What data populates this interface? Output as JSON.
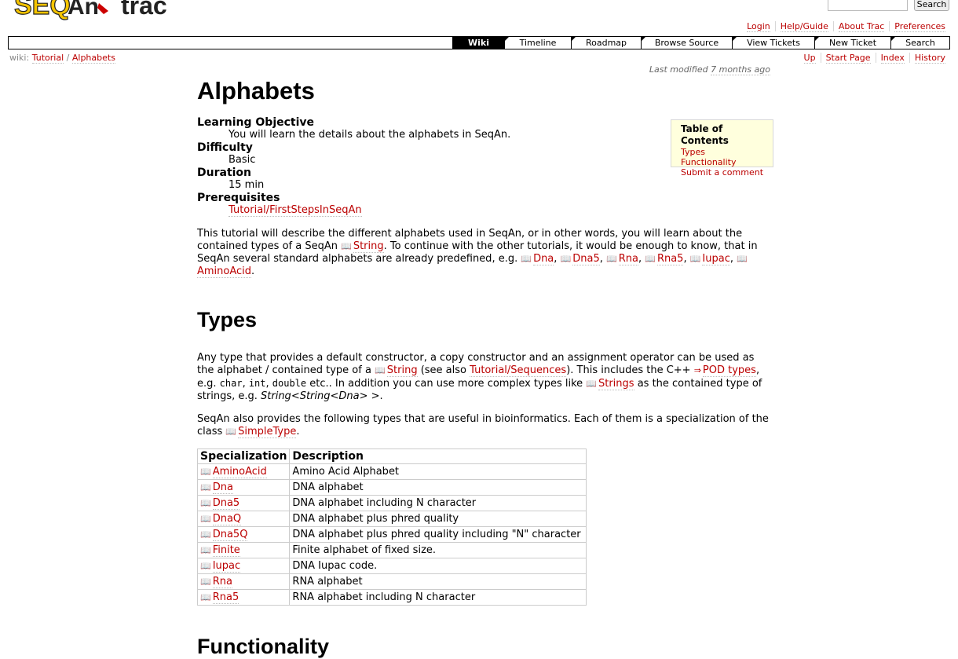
{
  "header": {
    "logo_text": "SEQAN trac",
    "search_button": "Search",
    "metanav": [
      "Login",
      "Help/Guide",
      "About Trac",
      "Preferences"
    ]
  },
  "mainnav": [
    {
      "label": "Wiki",
      "active": true
    },
    {
      "label": "Timeline"
    },
    {
      "label": "Roadmap"
    },
    {
      "label": "Browse Source"
    },
    {
      "label": "View Tickets"
    },
    {
      "label": "New Ticket"
    },
    {
      "label": "Search"
    }
  ],
  "ctxnav": {
    "wiki_prefix": "wiki:",
    "crumb1": "Tutorial",
    "sep": "/",
    "crumb2": "Alphabets",
    "links": [
      "Up",
      "Start Page",
      "Index",
      "History"
    ]
  },
  "last_modified": {
    "prefix": "Last modified",
    "age": "7 months ago"
  },
  "page": {
    "title": "Alphabets",
    "meta": [
      {
        "term": "Learning Objective",
        "desc": "You will learn the details about the alphabets in SeqAn."
      },
      {
        "term": "Difficulty",
        "desc": "Basic"
      },
      {
        "term": "Duration",
        "desc": "15 min"
      },
      {
        "term": "Prerequisites",
        "desc": "Tutorial/FirstStepsInSeqAn"
      }
    ],
    "intro": {
      "t1": "This tutorial will describe the different alphabets used in SeqAn, or in other words, you will learn about the contained types of a SeqAn ",
      "string": "String",
      "t2": ". To continue with the other tutorials, it would be enough to know, that in SeqAn several standard alphabets are already predefined, e.g. ",
      "dna": "Dna",
      "dna5": "Dna5",
      "rna": "Rna",
      "rna5": "Rna5",
      "iupac": "Iupac",
      "amino": "AminoAcid"
    },
    "types_heading": "Types",
    "types_p1": {
      "t1": "Any type that provides a default constructor, a copy constructor and an assignment operator can be used as the alphabet / contained type of a ",
      "string": "String",
      "t2": " (see also ",
      "seq": "Tutorial/Sequences",
      "t3": "). This includes the C++ ",
      "pod": "POD types",
      "t4": ", e.g. ",
      "c1": "char",
      "c2": "int",
      "c3": "double",
      "t5": " etc.. In addition you can use more complex types like ",
      "strings": "Strings",
      "t6": " as the contained type of strings, e.g. ",
      "ex": "String<String<Dna> >",
      "t7": "."
    },
    "types_p2": {
      "t1": "SeqAn also provides the following types that are useful in bioinformatics. Each of them is a specialization of the class ",
      "simple": "SimpleType",
      "t2": "."
    },
    "table": {
      "headers": [
        "Specialization",
        "Description"
      ],
      "rows": [
        [
          "AminoAcid",
          "Amino Acid Alphabet"
        ],
        [
          "Dna",
          "DNA alphabet"
        ],
        [
          "Dna5",
          "DNA alphabet including N character"
        ],
        [
          "DnaQ",
          "DNA alphabet plus phred quality"
        ],
        [
          "Dna5Q",
          "DNA alphabet plus phred quality including \"N\" character"
        ],
        [
          "Finite",
          "Finite alphabet of fixed size."
        ],
        [
          "Iupac",
          "DNA Iupac code."
        ],
        [
          "Rna",
          "RNA alphabet"
        ],
        [
          "Rna5",
          "RNA alphabet including N character"
        ]
      ]
    },
    "functionality_heading": "Functionality"
  },
  "toc": {
    "title": "Table of Contents",
    "entries": [
      "Types",
      "Functionality",
      "Submit a comment"
    ]
  },
  "colors": {
    "link": "#bb0000",
    "nav_active": "#000000",
    "toc_bg": "#ffffdd"
  }
}
